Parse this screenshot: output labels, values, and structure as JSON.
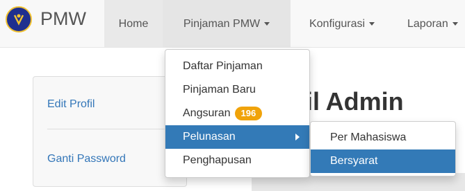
{
  "brand": {
    "name": "PMW"
  },
  "nav": {
    "home": "Home",
    "pinjaman": "Pinjaman PMW",
    "konfigurasi": "Konfigurasi",
    "laporan": "Laporan"
  },
  "dropdown": {
    "items": [
      {
        "label": "Daftar Pinjaman"
      },
      {
        "label": "Pinjaman Baru"
      },
      {
        "label": "Angsuran",
        "badge": "196"
      },
      {
        "label": "Pelunasan"
      },
      {
        "label": "Penghapusan"
      }
    ]
  },
  "submenu": {
    "items": [
      {
        "label": "Per Mahasiswa"
      },
      {
        "label": "Bersyarat"
      }
    ]
  },
  "sidebar": {
    "items": [
      {
        "label": "Edit Profil"
      },
      {
        "label": "Ganti Password"
      }
    ]
  },
  "main": {
    "heading": "il Admin"
  },
  "colors": {
    "accent": "#337ab7",
    "badge": "#f0a30a",
    "link": "#3376b8"
  }
}
